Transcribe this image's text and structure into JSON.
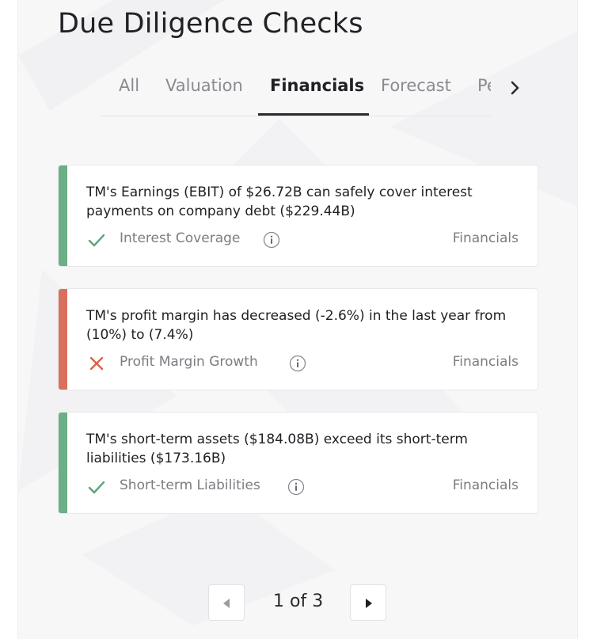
{
  "page": {
    "title": "Due Diligence Checks"
  },
  "tabs": [
    {
      "label": "All",
      "active": false
    },
    {
      "label": "Valuation",
      "active": false
    },
    {
      "label": "Financials",
      "active": true
    },
    {
      "label": "Forecast",
      "active": false
    },
    {
      "label": "Pe",
      "active": false
    }
  ],
  "tabs_next_icon": "chevron-right-icon",
  "checks": [
    {
      "description": "TM's Earnings (EBIT) of $26.72B can safely cover interest payments on company debt ($229.44B)",
      "name": "Interest Coverage",
      "category": "Financials",
      "passed": true,
      "status_icon": "check-icon",
      "info_icon": "info-icon",
      "accent_color": "#6aaf86"
    },
    {
      "description": "TM's profit margin has decreased (-2.6%) in the last year from (10%) to (7.4%)",
      "name": "Profit Margin Growth",
      "category": "Financials",
      "passed": false,
      "status_icon": "cross-icon",
      "info_icon": "info-icon",
      "accent_color": "#d9705e"
    },
    {
      "description": "TM's short-term assets ($184.08B) exceed its short-term liabilities ($173.16B)",
      "name": "Short-term Liabilities",
      "category": "Financials",
      "passed": true,
      "status_icon": "check-icon",
      "info_icon": "info-icon",
      "accent_color": "#6aaf86"
    }
  ],
  "pagination": {
    "label": "1 of 3",
    "prev_icon": "triangle-left-icon",
    "next_icon": "triangle-right-icon",
    "prev_enabled": false,
    "next_enabled": true
  },
  "colors": {
    "pass": "#6aaf86",
    "fail": "#d9705e",
    "pass_mark": "#5aa57a",
    "fail_mark": "#d9634f"
  }
}
